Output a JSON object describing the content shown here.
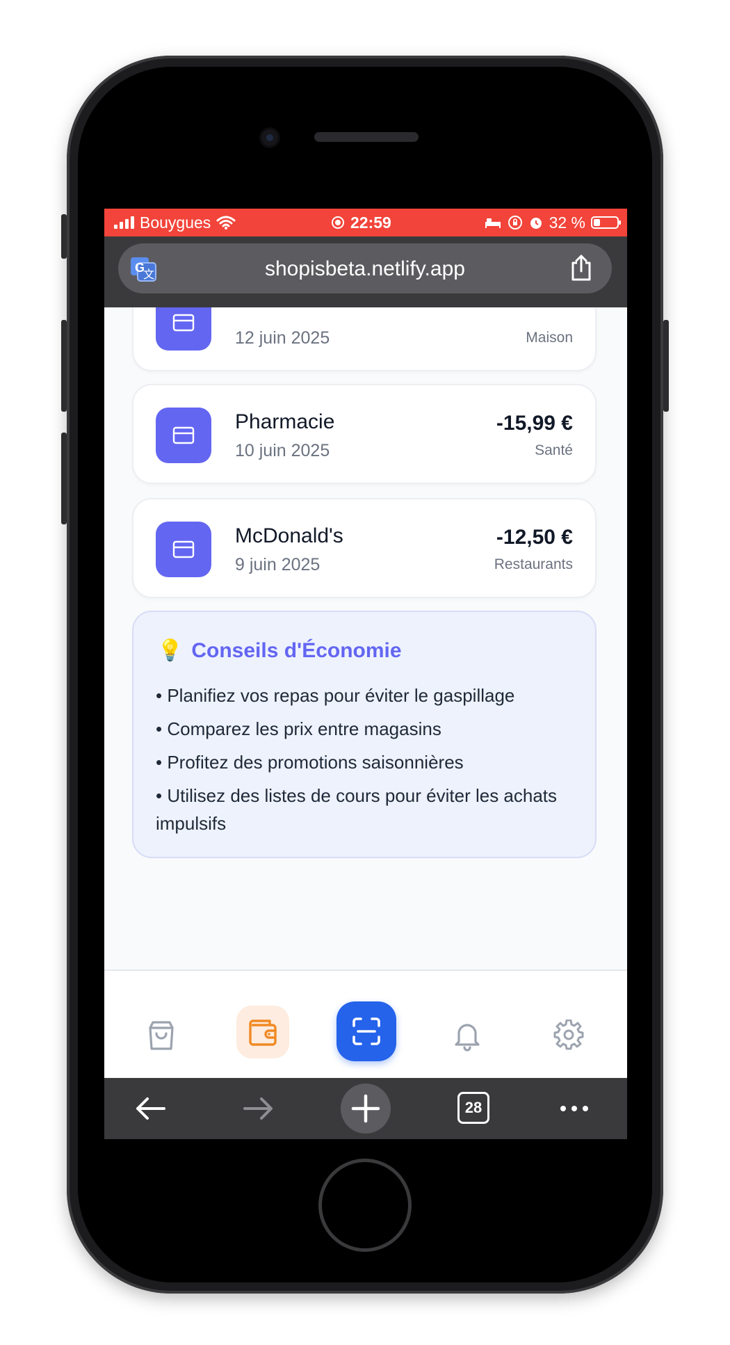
{
  "status_bar": {
    "carrier": "Bouygues",
    "time": "22:59",
    "battery": "32 %"
  },
  "browser": {
    "url": "shopisbeta.netlify.app",
    "tabs_count": "28"
  },
  "transactions": [
    {
      "name": "",
      "date": "12 juin 2025",
      "amount": "",
      "category": "Maison"
    },
    {
      "name": "Pharmacie",
      "date": "10 juin 2025",
      "amount": "-15,99 €",
      "category": "Santé"
    },
    {
      "name": "McDonald's",
      "date": "9 juin 2025",
      "amount": "-12,50 €",
      "category": "Restaurants"
    }
  ],
  "tips": {
    "emoji": "💡",
    "title": "Conseils d'Économie",
    "items": [
      "• Planifiez vos repas pour éviter le gaspillage",
      "• Comparez les prix entre magasins",
      "• Profitez des promotions saisonnières",
      "• Utilisez des listes de cours pour éviter les achats impulsifs"
    ]
  },
  "tabbar": {
    "items": [
      {
        "icon": "shopping-bag-icon",
        "active": false
      },
      {
        "icon": "wallet-icon",
        "active": true
      },
      {
        "icon": "scan-icon",
        "active": false
      },
      {
        "icon": "bell-icon",
        "active": false
      },
      {
        "icon": "gear-icon",
        "active": false
      }
    ]
  },
  "colors": {
    "accent": "#6366f1",
    "primary": "#2563eb",
    "wallet_active": "#f08a24",
    "status_bar": "#f2443a"
  }
}
